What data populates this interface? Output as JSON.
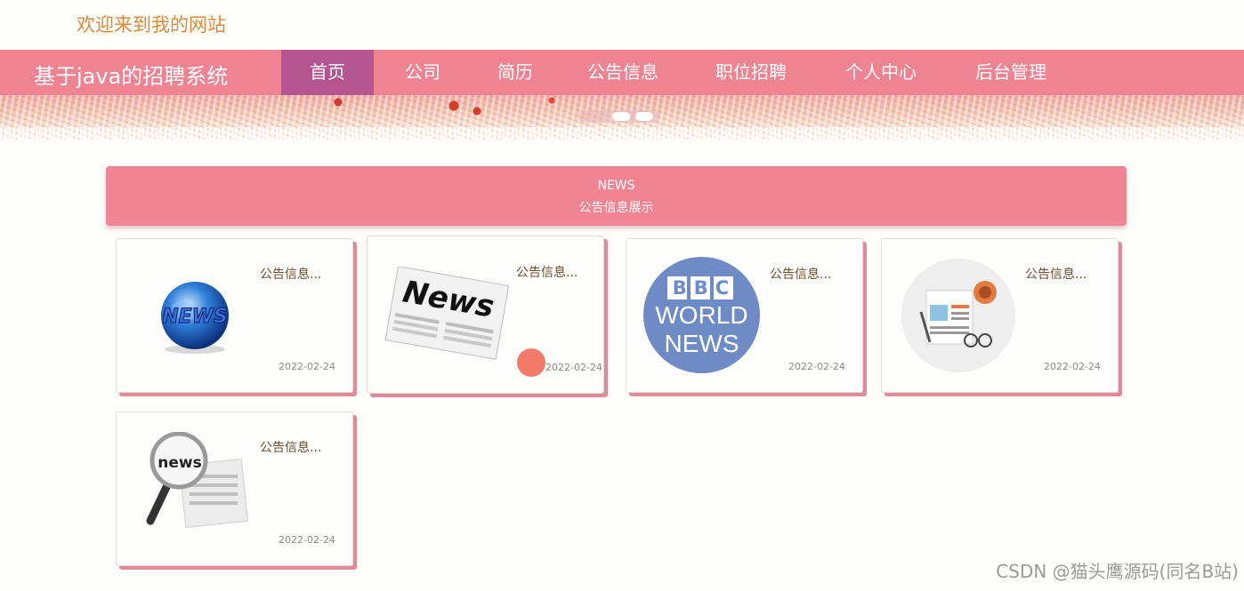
{
  "header": {
    "welcome": "欢迎来到我的网站",
    "brand": "基于java的招聘系统"
  },
  "nav": {
    "items": [
      {
        "label": "首页",
        "active": true
      },
      {
        "label": "公司",
        "active": false
      },
      {
        "label": "简历",
        "active": false
      },
      {
        "label": "公告信息",
        "active": false
      },
      {
        "label": "职位招聘",
        "active": false
      },
      {
        "label": "个人中心",
        "active": false
      },
      {
        "label": "后台管理",
        "active": false
      }
    ]
  },
  "section": {
    "title_en": "NEWS",
    "title_cn": "公告信息展示"
  },
  "cards": [
    {
      "title": "公告信息...",
      "date": "2022-02-24",
      "image": "news-globe-icon"
    },
    {
      "title": "公告信息...",
      "date": "2022-02-24",
      "image": "newspaper-icon"
    },
    {
      "title": "公告信息...",
      "date": "2022-02-24",
      "image": "bbc-world-news-logo",
      "logo": {
        "line1": "BBC",
        "line2": "WORLD",
        "line3": "NEWS"
      }
    },
    {
      "title": "公告信息...",
      "date": "2022-02-24",
      "image": "news-desk-icon"
    },
    {
      "title": "公告信息...",
      "date": "2022-02-24",
      "image": "magnifier-news-icon"
    }
  ],
  "watermark": "CSDN @猫头鹰源码(同名B站)",
  "colors": {
    "nav_bg": "#ee8391",
    "nav_active": "#b45590",
    "welcome": "#e0893a",
    "card_shadow": "#e38a98"
  }
}
